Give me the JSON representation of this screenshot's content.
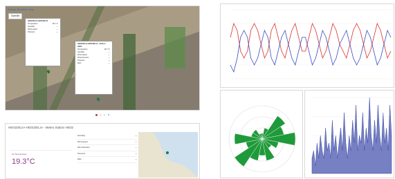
{
  "map": {
    "title": "Sensor Realtime Map",
    "button_label": "Satellite",
    "popup_small": {
      "header": "HE01DELIA-HE01DELIA",
      "rows": [
        {
          "label": "Temperature",
          "value": "19.3 °C"
        },
        {
          "label": "Humidity",
          "value": "—"
        },
        {
          "label": "Wind speed",
          "value": "—"
        },
        {
          "label": "Pressure",
          "value": "—"
        }
      ]
    },
    "popup_large": {
      "header": "HE01DELIA-HE01DELIA - Station HE02",
      "rows": [
        {
          "label": "Temperature",
          "value": "19.3 °C"
        },
        {
          "label": "Humidity",
          "value": "—"
        },
        {
          "label": "Wind speed",
          "value": "—"
        },
        {
          "label": "Wind direction",
          "value": "—"
        },
        {
          "label": "Pressure",
          "value": "—"
        },
        {
          "label": "Rain",
          "value": "—"
        }
      ]
    }
  },
  "station": {
    "header": "HE01DELIA-HE01DELIA - Meteo Station HE02",
    "temperature_label": "Air Temperature",
    "temperature_value": "19.3°C",
    "readings": [
      {
        "label": "Humidity",
        "value": "—"
      },
      {
        "label": "Wind speed",
        "value": "—"
      },
      {
        "label": "Wind direction",
        "value": "—"
      },
      {
        "label": "Pressure",
        "value": "—"
      },
      {
        "label": "Rain",
        "value": "—"
      }
    ]
  },
  "colors": {
    "series_a": "#d9302a",
    "series_b": "#3a4bbf",
    "rose": "#1f9a3a",
    "timeseries": "#3c4aa8"
  },
  "chart_data": [
    {
      "type": "line",
      "title": "",
      "xlabel": "",
      "ylabel": "",
      "grid": true,
      "series": [
        {
          "values": [
            6,
            8,
            7,
            4,
            3,
            4,
            7,
            8,
            7,
            5,
            3,
            4,
            7,
            8,
            6,
            4,
            3,
            5,
            7,
            8,
            6,
            4,
            4,
            6,
            8,
            7,
            5,
            3,
            4,
            6,
            8,
            7,
            5,
            4,
            3,
            5,
            7,
            8,
            7,
            5,
            3,
            4,
            6,
            8,
            7,
            5,
            3,
            4
          ]
        },
        {
          "values": [
            2,
            1,
            3,
            6,
            7,
            6,
            3,
            2,
            3,
            5,
            7,
            6,
            3,
            2,
            4,
            6,
            7,
            5,
            3,
            2,
            4,
            6,
            6,
            4,
            2,
            3,
            5,
            7,
            6,
            4,
            2,
            3,
            5,
            6,
            7,
            5,
            3,
            2,
            3,
            5,
            7,
            6,
            4,
            2,
            3,
            5,
            7,
            6
          ]
        }
      ]
    },
    {
      "type": "pie",
      "title": "",
      "categories": [
        "N",
        "NNE",
        "NE",
        "ENE",
        "E",
        "ESE",
        "SE",
        "SSE",
        "S",
        "SSW",
        "SW",
        "WSW",
        "W",
        "WNW",
        "NW",
        "NNW"
      ],
      "values": [
        1,
        2,
        5,
        4,
        6,
        3,
        2,
        4,
        3,
        4,
        6,
        3,
        5,
        2,
        2,
        1
      ]
    },
    {
      "type": "area",
      "title": "",
      "values": [
        2,
        3,
        1,
        4,
        2,
        5,
        3,
        2,
        6,
        3,
        4,
        2,
        7,
        3,
        5,
        2,
        4,
        6,
        3,
        8,
        4,
        2,
        5,
        3,
        7,
        4,
        9,
        3,
        5,
        4,
        8,
        3,
        6,
        4,
        10,
        5,
        3,
        7,
        4,
        9,
        5,
        3,
        8,
        4,
        6,
        3,
        9,
        5
      ]
    }
  ]
}
